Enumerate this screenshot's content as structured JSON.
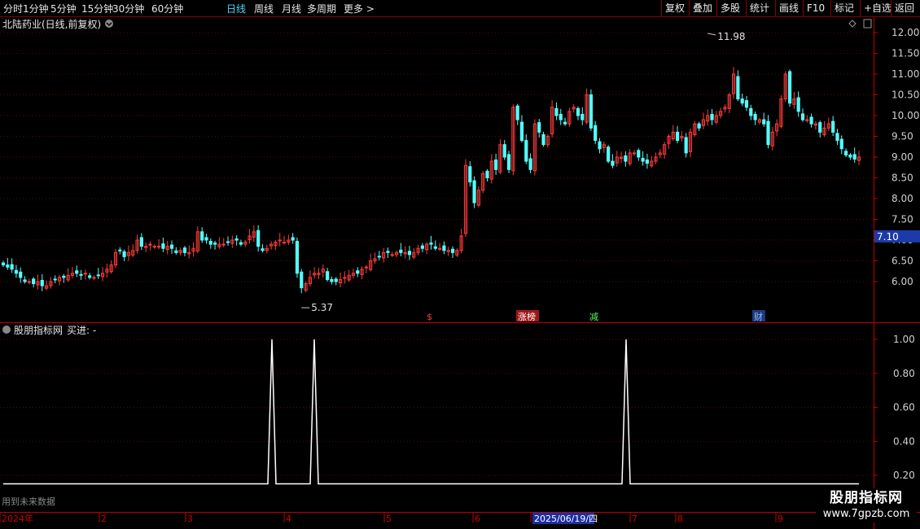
{
  "toolbar": {
    "periods": [
      "分时",
      "1分钟",
      "5分钟",
      "15分钟",
      "30分钟",
      "60分钟",
      "日线",
      "周线",
      "月线",
      "多周期",
      "更多 >"
    ],
    "active_period": "日线",
    "buttons": [
      "复权",
      "叠加",
      "多股",
      "统计",
      "画线",
      "F10",
      "标记",
      "+自选",
      "返回"
    ]
  },
  "main_panel": {
    "title": "北陆药业(日线,前复权)",
    "y_ticks": [
      "12.00",
      "11.50",
      "11.00",
      "10.50",
      "10.00",
      "9.50",
      "9.00",
      "8.50",
      "8.00",
      "7.50",
      "7.00",
      "6.50",
      "6.00"
    ],
    "current_price": "7.10",
    "high_label": "11.98",
    "low_label": "5.37",
    "event_markers": [
      {
        "text": "$",
        "color": "#ff3b3b"
      },
      {
        "text": "涨榜",
        "color": "#ffffff",
        "bg": "#a01818"
      },
      {
        "text": "减",
        "color": "#50ff50"
      },
      {
        "text": "财",
        "color": "#8fb8ff",
        "bg": "#1f3a7a"
      }
    ],
    "up_color": "#ff3b3b",
    "down_color": "#54ffff"
  },
  "indicator_panel": {
    "title": "股朋指标网",
    "label": "买进: -",
    "y_ticks": [
      "1.00",
      "0.80",
      "0.60",
      "0.40",
      "0.20"
    ],
    "note": "用到未来数据"
  },
  "x_axis": {
    "labels": [
      "2024年",
      "2",
      "3",
      "4",
      "5",
      "6",
      "2025/06/19/四",
      "7",
      "8",
      "9"
    ]
  },
  "watermark": {
    "title": "股朋指标网",
    "url": "www.7gpzb.com"
  },
  "chart_data": {
    "type": "candlestick",
    "title": "北陆药业(日线,前复权)",
    "ylim": [
      5.2,
      12.2
    ],
    "y_ticks": [
      6.0,
      6.5,
      7.0,
      7.5,
      8.0,
      8.5,
      9.0,
      9.5,
      10.0,
      10.5,
      11.0,
      11.5,
      12.0
    ],
    "high": 11.98,
    "low": 5.37,
    "last": 7.1,
    "close": [
      6.4,
      6.35,
      6.3,
      6.2,
      6.1,
      6.0,
      6.0,
      5.95,
      6.0,
      5.9,
      5.9,
      6.0,
      6.05,
      6.1,
      6.1,
      6.15,
      6.2,
      6.2,
      6.15,
      6.2,
      6.1,
      6.1,
      6.15,
      6.2,
      6.3,
      6.4,
      6.7,
      6.75,
      6.6,
      6.7,
      6.75,
      7.0,
      6.85,
      6.85,
      6.9,
      6.85,
      6.85,
      6.8,
      6.85,
      6.8,
      6.7,
      6.75,
      6.7,
      6.7,
      6.8,
      7.2,
      7.0,
      7.0,
      6.9,
      6.9,
      6.9,
      6.9,
      6.95,
      7.0,
      7.0,
      6.9,
      6.95,
      7.1,
      7.2,
      6.85,
      6.75,
      6.8,
      6.9,
      6.95,
      7.0,
      6.95,
      7.0,
      7.0,
      6.2,
      5.85,
      5.95,
      6.1,
      6.2,
      6.2,
      6.3,
      6.05,
      6.0,
      6.0,
      6.05,
      6.1,
      6.15,
      6.2,
      6.2,
      6.3,
      6.35,
      6.5,
      6.55,
      6.6,
      6.7,
      6.7,
      6.65,
      6.7,
      6.7,
      6.7,
      6.65,
      6.7,
      6.8,
      6.8,
      6.9,
      6.9,
      6.8,
      6.8,
      6.75,
      6.75,
      6.7,
      6.75,
      7.1,
      8.8,
      8.4,
      7.9,
      8.2,
      8.6,
      8.5,
      8.9,
      8.7,
      9.3,
      9.0,
      8.7,
      10.2,
      9.9,
      9.4,
      8.9,
      8.7,
      9.8,
      9.6,
      9.3,
      9.5,
      10.2,
      10.0,
      9.9,
      9.8,
      10.1,
      10.2,
      10.0,
      9.9,
      10.5,
      9.7,
      9.4,
      9.2,
      9.3,
      8.9,
      8.8,
      9.0,
      9.0,
      8.9,
      9.1,
      9.1,
      9.0,
      8.9,
      8.85,
      8.9,
      9.0,
      9.1,
      9.3,
      9.5,
      9.6,
      9.4,
      9.5,
      9.1,
      9.6,
      9.8,
      9.7,
      9.9,
      10.0,
      9.9,
      10.0,
      10.1,
      10.2,
      10.5,
      11.0,
      10.4,
      10.3,
      10.2,
      10.0,
      9.9,
      9.9,
      9.8,
      9.3,
      9.6,
      9.8,
      10.4,
      11.0,
      10.3,
      10.4,
      10.1,
      9.9,
      9.9,
      9.8,
      9.8,
      9.6,
      9.7,
      9.8,
      9.6,
      9.4,
      9.2,
      9.05,
      9.0,
      8.95,
      9.0
    ]
  }
}
